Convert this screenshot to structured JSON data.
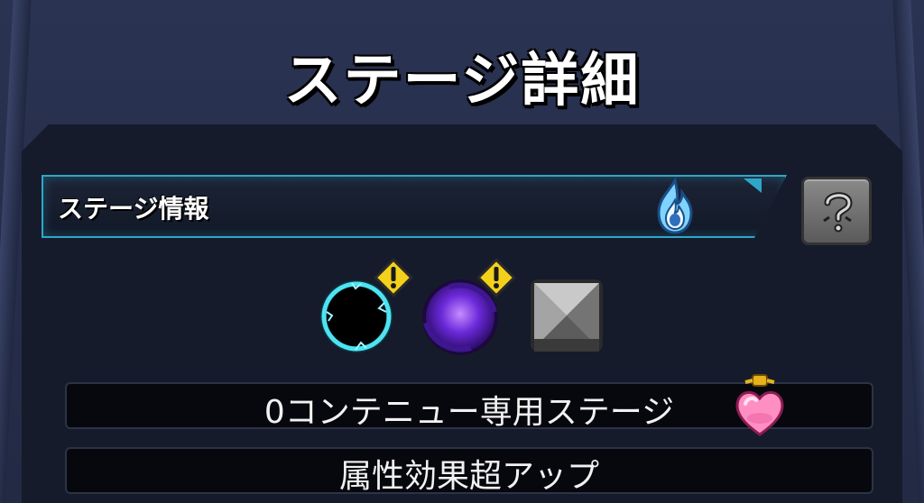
{
  "screen": {
    "title": "ステージ詳細"
  },
  "stage_info": {
    "label": "ステージ情報",
    "element_icon": "blue-flame-icon",
    "help_icon": "question-mark-icon"
  },
  "gimmicks": [
    {
      "icon": "black-hole-icon",
      "warning": true
    },
    {
      "icon": "purple-vortex-icon",
      "warning": true
    },
    {
      "icon": "metal-block-icon",
      "warning": false
    }
  ],
  "conditions": [
    {
      "text": "0コンテニュー専用ステージ",
      "icon": "heart-potion-icon"
    },
    {
      "text": "属性効果超アップ"
    }
  ],
  "colors": {
    "accent": "#2fa6c8",
    "warning": "#f3d11b"
  }
}
